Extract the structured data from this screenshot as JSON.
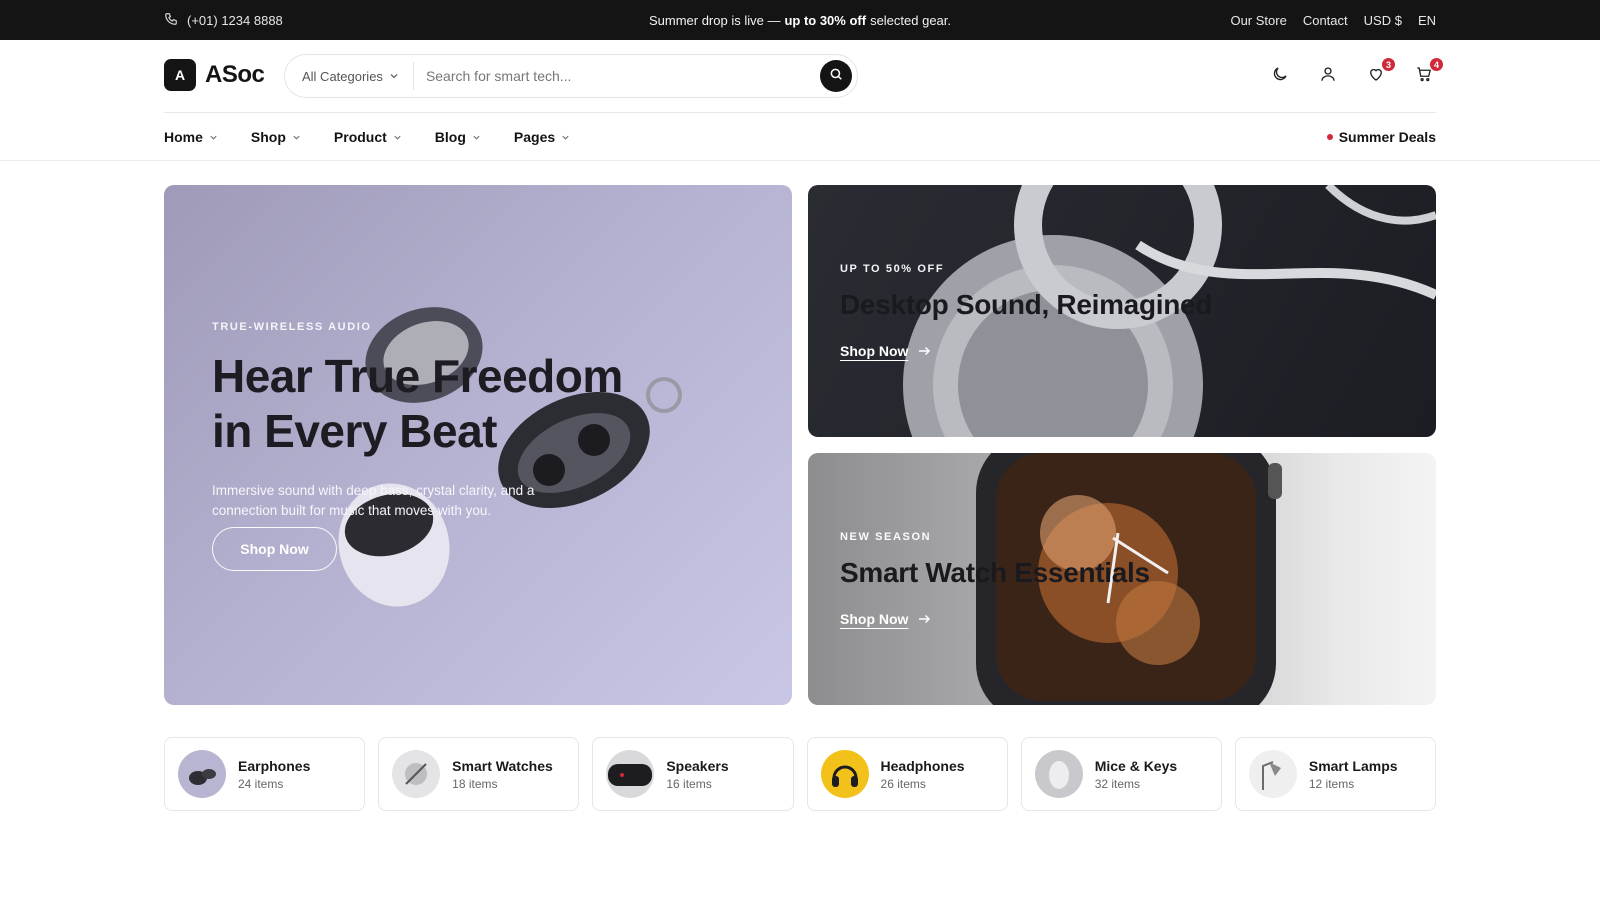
{
  "topbar": {
    "phone": "(+01) 1234 8888",
    "promo_prefix": "Summer drop is live —",
    "promo_bold": "up to 30% off",
    "promo_suffix": "selected gear.",
    "links": [
      "Our Store",
      "Contact",
      "USD $",
      "EN"
    ]
  },
  "header": {
    "logo_mark": "A",
    "logo_text": "ASoc",
    "category_select": "All Categories",
    "search_placeholder": "Search for smart tech...",
    "wishlist_count": "3",
    "cart_count": "4"
  },
  "nav": {
    "items": [
      "Home",
      "Shop",
      "Product",
      "Blog",
      "Pages"
    ],
    "deals": "Summer Deals"
  },
  "hero_main": {
    "eyebrow": "TRUE-WIRELESS AUDIO",
    "title_line1": "Hear True Freedom",
    "title_line2": "in Every Beat",
    "description": "Immersive sound with deep bass, crystal clarity, and a connection built for music that moves with you.",
    "button": "Shop Now"
  },
  "hero_a": {
    "eyebrow": "UP TO 50% OFF",
    "title": "Desktop Sound, Reimagined",
    "link": "Shop Now"
  },
  "hero_b": {
    "eyebrow": "NEW SEASON",
    "title": "Smart Watch Essentials",
    "link": "Shop Now"
  },
  "categories": [
    {
      "name": "Earphones",
      "count": "24 items"
    },
    {
      "name": "Smart Watches",
      "count": "18 items"
    },
    {
      "name": "Speakers",
      "count": "16 items"
    },
    {
      "name": "Headphones",
      "count": "26 items"
    },
    {
      "name": "Mice & Keys",
      "count": "32 items"
    },
    {
      "name": "Smart Lamps",
      "count": "12 items"
    }
  ],
  "colors": {
    "topbar_bg": "#141414",
    "accent_badge": "#d1283a",
    "hero_main_bg": "#b4b1d0"
  }
}
